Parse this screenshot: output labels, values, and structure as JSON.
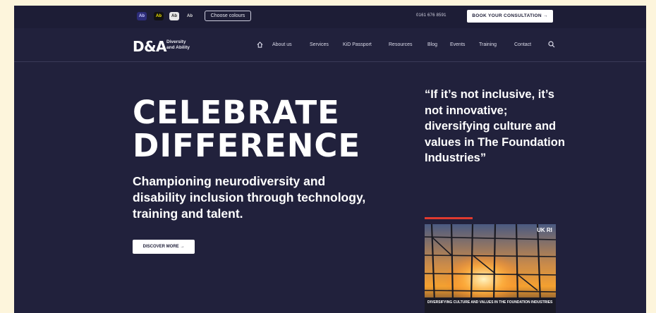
{
  "topbar": {
    "swatches": [
      "Ab",
      "Ab",
      "Ab",
      "Ab"
    ],
    "choose_colours": "Choose colours",
    "phone": "0161 676 8591",
    "consultation_button": "BOOK YOUR CONSULTATION →"
  },
  "brand": {
    "logo": "D&A",
    "name_line1": "Diversity",
    "name_line2": "and Ability"
  },
  "nav": {
    "items": [
      "About us",
      "Services",
      "KiD Passport",
      "Resources",
      "Blog",
      "Events",
      "Training",
      "Contact"
    ]
  },
  "hero": {
    "title_line1": "CELEBRATE",
    "title_line2": "DIFFERENCE",
    "subtitle": "Championing neurodiversity and disability inclusion through technology, training and talent.",
    "cta": "DISCOVER MORE →"
  },
  "quote": {
    "text": "“If it’s not inclusive, it’s not innovative; diversifying culture and values in The Foundation Industries”",
    "cover_caption": "DIVERSIFYING CULTURE AND VALUES IN THE FOUNDATION INDUSTRIES",
    "cover_badge": "UK RI"
  },
  "colors": {
    "background": "#21213c",
    "accent_red": "#e03a2f",
    "page_margin": "#fdf5dc"
  },
  "icons": [
    "home-icon",
    "search-icon"
  ]
}
